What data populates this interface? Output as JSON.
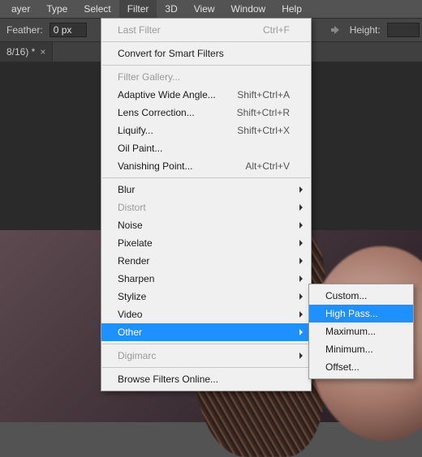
{
  "menubar": {
    "items": [
      "ayer",
      "Type",
      "Select",
      "Filter",
      "3D",
      "View",
      "Window",
      "Help"
    ],
    "open_index": 3
  },
  "toolbar": {
    "feather_label": "Feather:",
    "feather_value": "0 px",
    "height_label": "Height:"
  },
  "tab": {
    "title": "8/16) *",
    "close": "×"
  },
  "menu": {
    "last_filter": "Last Filter",
    "last_filter_sc": "Ctrl+F",
    "convert_smart": "Convert for Smart Filters",
    "filter_gallery": "Filter Gallery...",
    "adaptive": "Adaptive Wide Angle...",
    "adaptive_sc": "Shift+Ctrl+A",
    "lens": "Lens Correction...",
    "lens_sc": "Shift+Ctrl+R",
    "liquify": "Liquify...",
    "liquify_sc": "Shift+Ctrl+X",
    "oil": "Oil Paint...",
    "vanishing": "Vanishing Point...",
    "vanishing_sc": "Alt+Ctrl+V",
    "blur": "Blur",
    "distort": "Distort",
    "noise": "Noise",
    "pixelate": "Pixelate",
    "render": "Render",
    "sharpen": "Sharpen",
    "stylize": "Stylize",
    "video": "Video",
    "other": "Other",
    "digimarc": "Digimarc",
    "browse": "Browse Filters Online..."
  },
  "submenu": {
    "custom": "Custom...",
    "highpass": "High Pass...",
    "maximum": "Maximum...",
    "minimum": "Minimum...",
    "offset": "Offset..."
  }
}
